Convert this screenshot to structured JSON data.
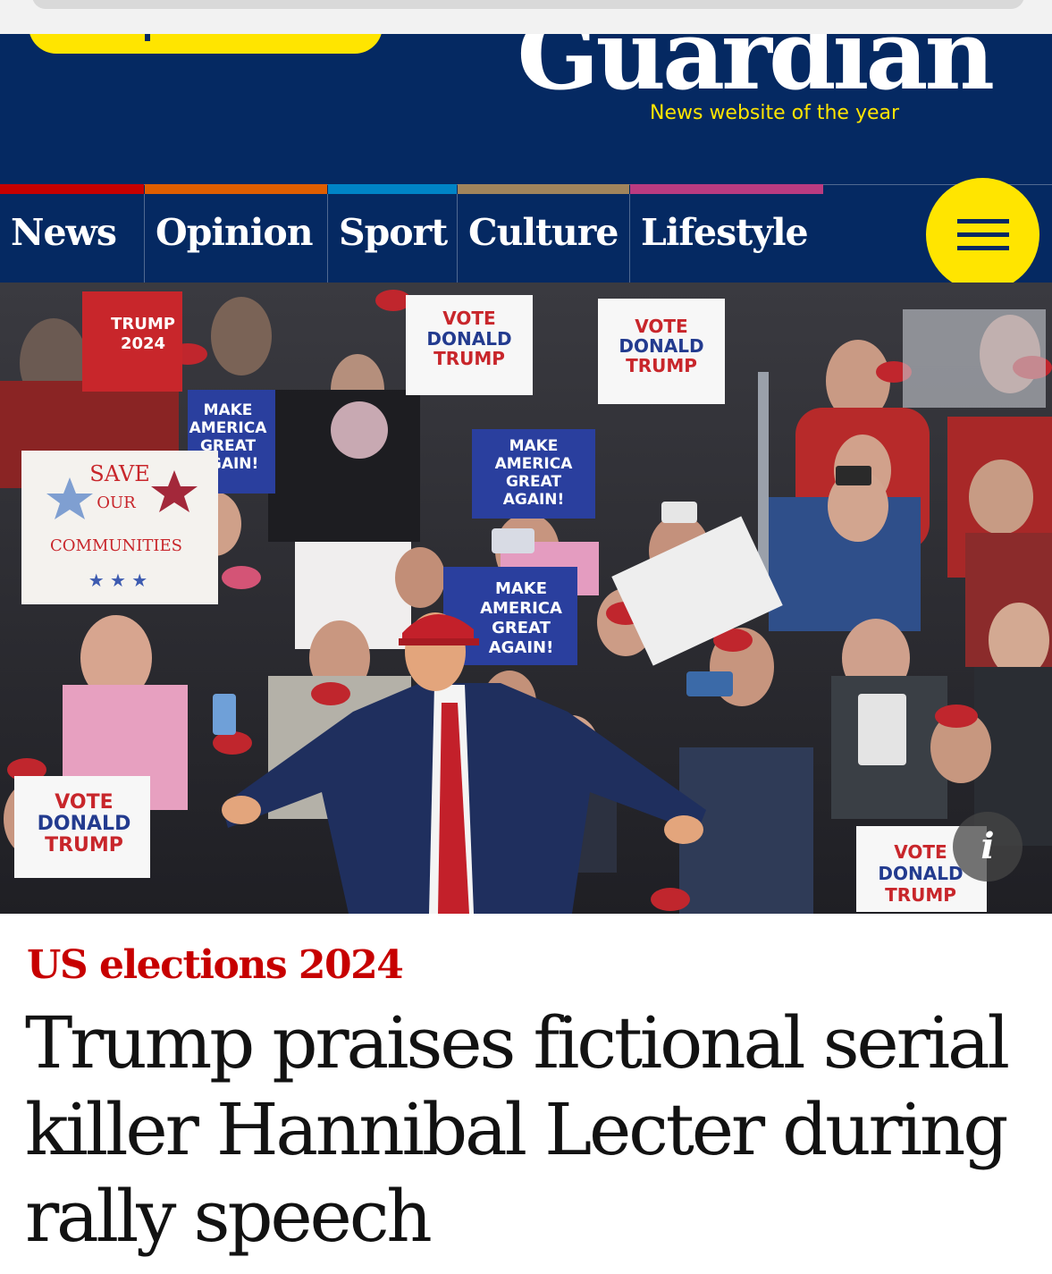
{
  "masthead": {
    "logo_text": "Guardian",
    "tagline": "News website of the year"
  },
  "nav": {
    "items": [
      {
        "label": "News",
        "accent": "#c70000"
      },
      {
        "label": "Opinion",
        "accent": "#e05e00"
      },
      {
        "label": "Sport",
        "accent": "#0084c6"
      },
      {
        "label": "Culture",
        "accent": "#a1845c"
      },
      {
        "label": "Lifestyle",
        "accent": "#bb3b80"
      }
    ],
    "menu_icon": "hamburger-icon"
  },
  "hero": {
    "signs": {
      "vote_donald_trump": [
        "VOTE",
        "DONALD",
        "TRUMP"
      ],
      "maga": [
        "MAKE",
        "AMERICA",
        "GREAT",
        "AGAIN!"
      ],
      "save_communities": [
        "SAVE",
        "OUR",
        "COMMUNITIES"
      ],
      "trump_2024": [
        "TRUMP",
        "2024"
      ]
    },
    "info_icon": "info-icon",
    "info_label": "i"
  },
  "article": {
    "kicker": "US elections 2024",
    "headline": "Trump praises fictional serial killer Hannibal Lecter during rally speech"
  },
  "colors": {
    "brand_blue": "#052962",
    "brand_yellow": "#ffe500",
    "kicker_red": "#c70000",
    "headline": "#121212"
  }
}
